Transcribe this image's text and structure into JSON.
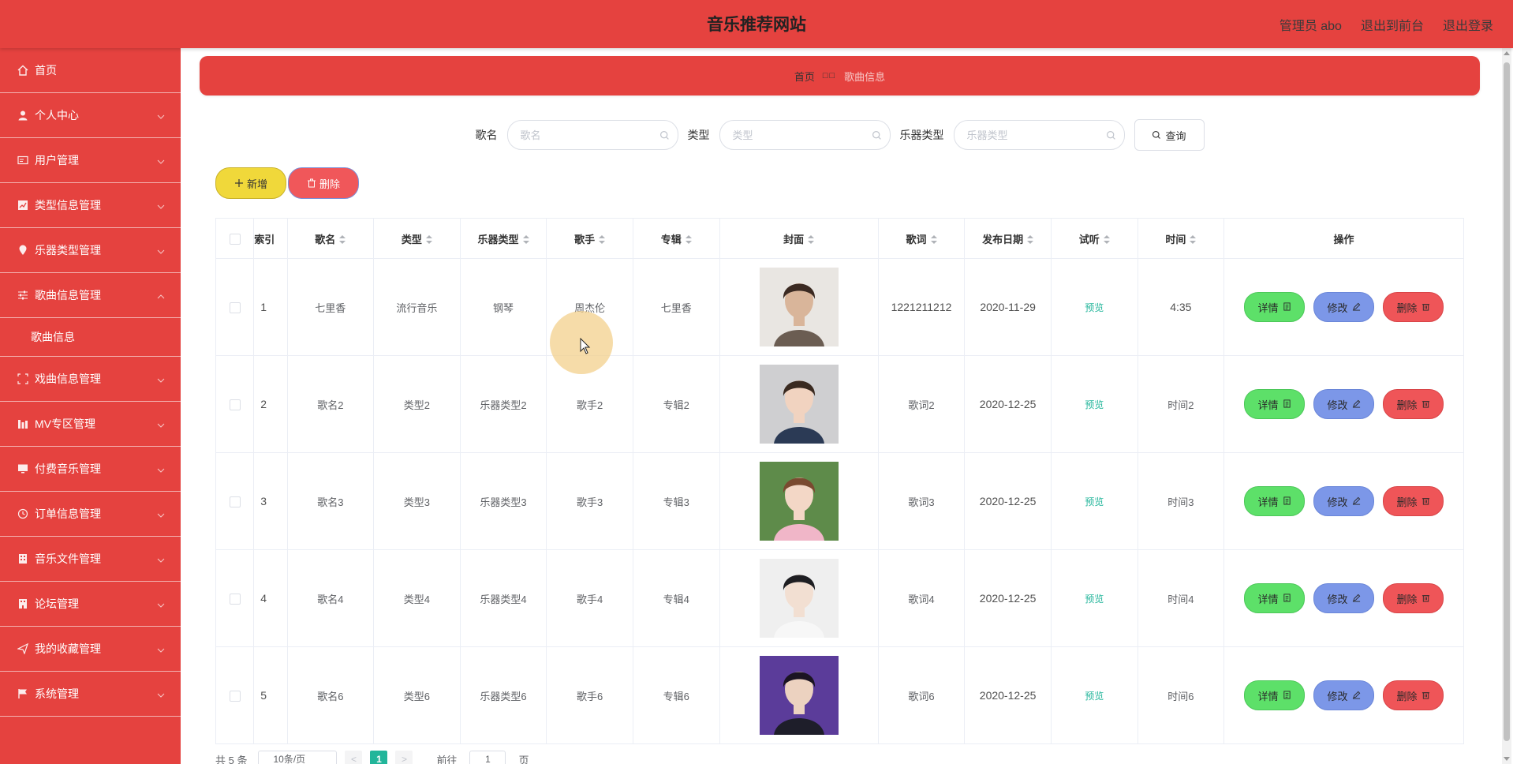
{
  "header": {
    "title": "音乐推荐网站",
    "admin": "管理员 abo",
    "back_front": "退出到前台",
    "logout": "退出登录"
  },
  "sidebar": {
    "items": [
      {
        "label": "首页",
        "icon": "home-icon",
        "has_arrow": false
      },
      {
        "label": "个人中心",
        "icon": "user-icon",
        "has_arrow": true
      },
      {
        "label": "用户管理",
        "icon": "card-icon",
        "has_arrow": true
      },
      {
        "label": "类型信息管理",
        "icon": "chart-icon",
        "has_arrow": true
      },
      {
        "label": "乐器类型管理",
        "icon": "location-icon",
        "has_arrow": true
      },
      {
        "label": "歌曲信息管理",
        "icon": "sliders-icon",
        "has_arrow": true,
        "expanded": true
      },
      {
        "label": "戏曲信息管理",
        "icon": "fullscreen-icon",
        "has_arrow": true
      },
      {
        "label": "MV专区管理",
        "icon": "bars-icon",
        "has_arrow": true
      },
      {
        "label": "付费音乐管理",
        "icon": "monitor-icon",
        "has_arrow": true
      },
      {
        "label": "订单信息管理",
        "icon": "clock-icon",
        "has_arrow": true
      },
      {
        "label": "音乐文件管理",
        "icon": "building-icon",
        "has_arrow": true
      },
      {
        "label": "论坛管理",
        "icon": "building2-icon",
        "has_arrow": true
      },
      {
        "label": "我的收藏管理",
        "icon": "send-icon",
        "has_arrow": true
      },
      {
        "label": "系统管理",
        "icon": "flag-icon",
        "has_arrow": true
      }
    ],
    "sub_item": "歌曲信息"
  },
  "breadcrumb": {
    "home": "首页",
    "sep": "□□",
    "current": "歌曲信息"
  },
  "search": {
    "song_label": "歌名",
    "song_placeholder": "歌名",
    "type_label": "类型",
    "type_placeholder": "类型",
    "instrument_label": "乐器类型",
    "instrument_placeholder": "乐器类型",
    "query_button": "查询"
  },
  "actions": {
    "add": "新增",
    "delete": "删除"
  },
  "table": {
    "headers": [
      "索引",
      "歌名",
      "类型",
      "乐器类型",
      "歌手",
      "专辑",
      "封面",
      "歌词",
      "发布日期",
      "试听",
      "时间",
      "操作"
    ],
    "rows": [
      {
        "index": "1",
        "name": "七里香",
        "type": "流行音乐",
        "instrument": "钢琴",
        "singer": "周杰伦",
        "album": "七里香",
        "lyrics": "1221211212",
        "date": "2020-11-29",
        "preview": "预览",
        "time": "4:35",
        "cover": "cover-1"
      },
      {
        "index": "2",
        "name": "歌名2",
        "type": "类型2",
        "instrument": "乐器类型2",
        "singer": "歌手2",
        "album": "专辑2",
        "lyrics": "歌词2",
        "date": "2020-12-25",
        "preview": "预览",
        "time": "时间2",
        "cover": "cover-2"
      },
      {
        "index": "3",
        "name": "歌名3",
        "type": "类型3",
        "instrument": "乐器类型3",
        "singer": "歌手3",
        "album": "专辑3",
        "lyrics": "歌词3",
        "date": "2020-12-25",
        "preview": "预览",
        "time": "时间3",
        "cover": "cover-3"
      },
      {
        "index": "4",
        "name": "歌名4",
        "type": "类型4",
        "instrument": "乐器类型4",
        "singer": "歌手4",
        "album": "专辑4",
        "lyrics": "歌词4",
        "date": "2020-12-25",
        "preview": "预览",
        "time": "时间4",
        "cover": "cover-4"
      },
      {
        "index": "5",
        "name": "歌名6",
        "type": "类型6",
        "instrument": "乐器类型6",
        "singer": "歌手6",
        "album": "专辑6",
        "lyrics": "歌词6",
        "date": "2020-12-25",
        "preview": "预览",
        "time": "时间6",
        "cover": "cover-5"
      }
    ],
    "op_detail": "详情",
    "op_edit": "修改",
    "op_delete": "删除"
  },
  "pager": {
    "total": "共 5 条",
    "size": "10条/页",
    "prev": "<",
    "current": "1",
    "next": ">",
    "goto_prefix": "前往",
    "goto_value": "1",
    "goto_suffix": "页"
  },
  "colors": {
    "brand": "#e5423f",
    "detail": "#5de069",
    "edit": "#7c97e8",
    "delete": "#ef5558",
    "add": "#f0d83a",
    "preview": "#22b59a"
  }
}
